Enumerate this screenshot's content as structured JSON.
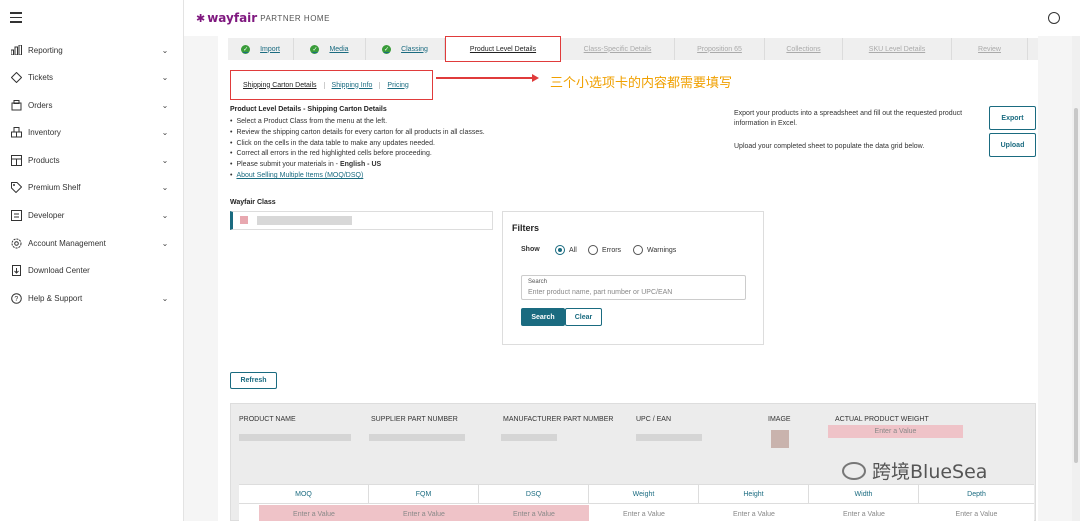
{
  "header": {
    "brand": "wayfair",
    "brand_sub": "PARTNER HOME"
  },
  "sidebar": {
    "items": [
      {
        "label": "Reporting",
        "icon": "bar-chart-icon",
        "chevron": true
      },
      {
        "label": "Tickets",
        "icon": "ticket-icon",
        "chevron": true
      },
      {
        "label": "Orders",
        "icon": "box-icon",
        "chevron": true
      },
      {
        "label": "Inventory",
        "icon": "boxes-icon",
        "chevron": true
      },
      {
        "label": "Products",
        "icon": "grid-icon",
        "chevron": true
      },
      {
        "label": "Premium Shelf",
        "icon": "tag-icon",
        "chevron": true
      },
      {
        "label": "Developer",
        "icon": "code-icon",
        "chevron": true
      },
      {
        "label": "Account Management",
        "icon": "gear-icon",
        "chevron": true
      },
      {
        "label": "Download Center",
        "icon": "download-icon",
        "chevron": false
      },
      {
        "label": "Help & Support",
        "icon": "help-icon",
        "chevron": true
      }
    ]
  },
  "steps": [
    {
      "label": "Import",
      "state": "done"
    },
    {
      "label": "Media",
      "state": "done"
    },
    {
      "label": "Classing",
      "state": "done"
    },
    {
      "label": "Product Level Details",
      "state": "active"
    },
    {
      "label": "Class-Specific Details",
      "state": "todo"
    },
    {
      "label": "Proposition 65",
      "state": "todo"
    },
    {
      "label": "Collections",
      "state": "todo"
    },
    {
      "label": "SKU Level Details",
      "state": "todo"
    },
    {
      "label": "Review",
      "state": "todo"
    }
  ],
  "subtabs": [
    "Shipping Carton Details",
    "Shipping Info",
    "Pricing"
  ],
  "annotation": "三个小选项卡的内容都需要填写",
  "details": {
    "title": "Product Level Details - Shipping Carton Details",
    "items": [
      "Select a Product Class from the menu at the left.",
      "Review the shipping carton details for every carton for all products in all classes.",
      "Click on the cells in the data table to make any updates needed.",
      "Correct all errors in the red highlighted cells before proceeding."
    ],
    "language_prefix": "Please submit your materials in - ",
    "language": "English - US",
    "link": "About Selling Multiple Items (MOQ/DSQ)"
  },
  "export_text": "Export your products into a spreadsheet and fill out the requested product information in Excel.",
  "upload_text": "Upload your completed sheet to populate the data grid below.",
  "export_label": "Export",
  "upload_label": "Upload",
  "wayfair_class_label": "Wayfair Class",
  "filters": {
    "title": "Filters",
    "show_label": "Show",
    "options": [
      "All",
      "Errors",
      "Warnings"
    ],
    "selected": "All",
    "search_caption": "Search",
    "search_placeholder": "Enter product name, part number or UPC/EAN",
    "search_btn": "Search",
    "clear_btn": "Clear"
  },
  "refresh_label": "Refresh",
  "table": {
    "headers": [
      "PRODUCT NAME",
      "SUPPLIER PART NUMBER",
      "MANUFACTURER PART NUMBER",
      "UPC / EAN",
      "IMAGE",
      "ACTUAL PRODUCT WEIGHT"
    ],
    "enter_value": "Enter a Value",
    "sub_headers": [
      "MOQ",
      "FQM",
      "DSQ",
      "Weight",
      "Height",
      "Width",
      "Depth"
    ]
  },
  "watermark": "跨境BlueSea",
  "colors": {
    "brand": "#7f187f",
    "teal": "#1a6b80",
    "error_cell": "#efc3c8",
    "annotation_red": "#e03b3b",
    "annotation_text": "#f0a000"
  }
}
